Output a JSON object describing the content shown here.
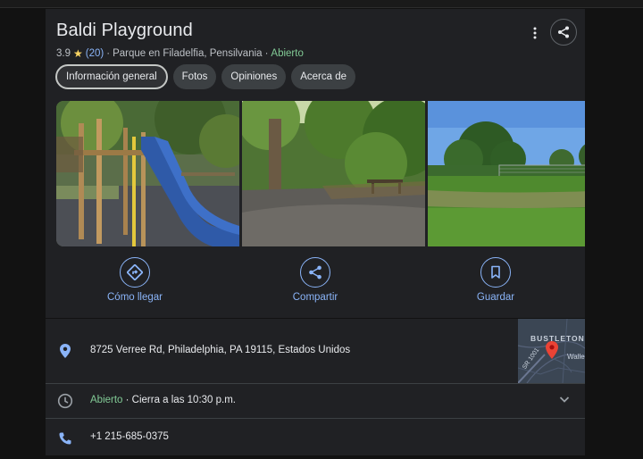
{
  "place": {
    "name": "Baldi Playground",
    "rating": "3.9",
    "star": "★",
    "review_count": "(20)",
    "category": "Parque en Filadelfia, Pensilvania",
    "separator": "·",
    "status": "Abierto"
  },
  "tabs": [
    {
      "label": "Información general",
      "active": true
    },
    {
      "label": "Fotos",
      "active": false
    },
    {
      "label": "Opiniones",
      "active": false
    },
    {
      "label": "Acerca de",
      "active": false
    }
  ],
  "actions": {
    "directions": "Cómo llegar",
    "share": "Compartir",
    "save": "Guardar"
  },
  "details": {
    "address": "8725 Verree Rd, Philadelphia, PA 19115, Estados Unidos",
    "hours_status": "Abierto",
    "hours_rest": " · Cierra a las 10:30 p.m.",
    "phone": "+1 215-685-0375"
  },
  "map": {
    "area_label": "BUSTLETON",
    "road_label": "SR 1001",
    "street_label": "Walle"
  },
  "colors": {
    "accent": "#8ab4f8",
    "open": "#81c995",
    "star": "#fdd663",
    "panel": "#202124",
    "pin": "#ea4335"
  }
}
